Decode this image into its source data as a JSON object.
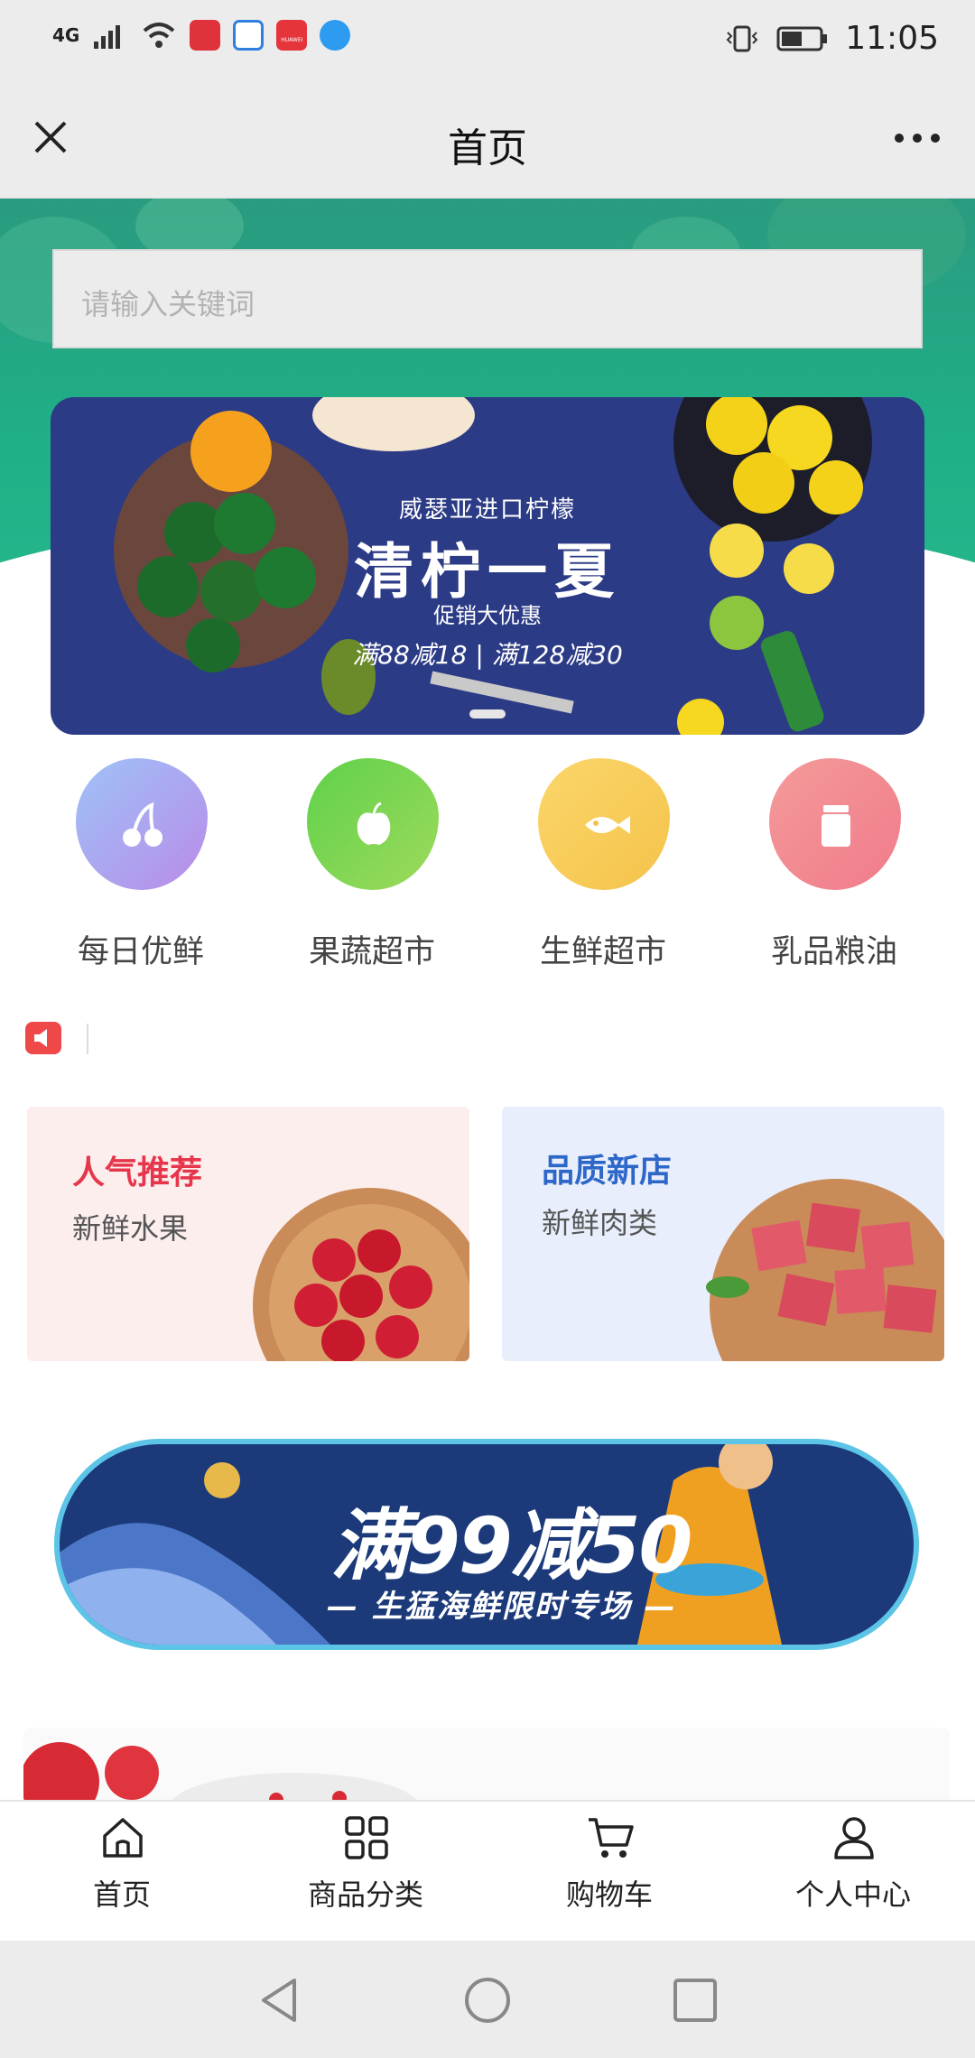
{
  "status": {
    "network": "4G",
    "time": "11:05",
    "app_icons": [
      "book-app-icon",
      "chat-app-icon",
      "huawei-store-icon",
      "browser-app-icon"
    ],
    "huawei_text": "HUAWEI"
  },
  "titlebar": {
    "title": "首页"
  },
  "search": {
    "placeholder": "请输入关键词"
  },
  "banner": {
    "subtitle": "威瑟亚进口柠檬",
    "title": "清柠一夏",
    "tagline": "促销大优惠",
    "offer": "满88减18 | 满128减30"
  },
  "categories": [
    {
      "label": "每日优鲜",
      "icon": "cherry-icon",
      "color": "#8fa3f0"
    },
    {
      "label": "果蔬超市",
      "icon": "apple-icon",
      "color": "#7ad04a"
    },
    {
      "label": "生鲜超市",
      "icon": "fish-icon",
      "color": "#f8cf5e"
    },
    {
      "label": "乳品粮油",
      "icon": "jar-icon",
      "color": "#f29090"
    }
  ],
  "feature_cards": [
    {
      "title": "人气推荐",
      "subtitle": "新鲜水果",
      "title_color": "#e6364b",
      "bg": "#fdeeee"
    },
    {
      "title": "品质新店",
      "subtitle": "新鲜肉类",
      "title_color": "#2d67c8",
      "bg": "#e8eefb"
    }
  ],
  "promo": {
    "headline": "满99减50",
    "subline": "— 生猛海鲜限时专场 —"
  },
  "tabbar": [
    {
      "label": "首页",
      "icon": "home-icon"
    },
    {
      "label": "商品分类",
      "icon": "grid-icon"
    },
    {
      "label": "购物车",
      "icon": "cart-icon"
    },
    {
      "label": "个人中心",
      "icon": "user-icon"
    }
  ]
}
